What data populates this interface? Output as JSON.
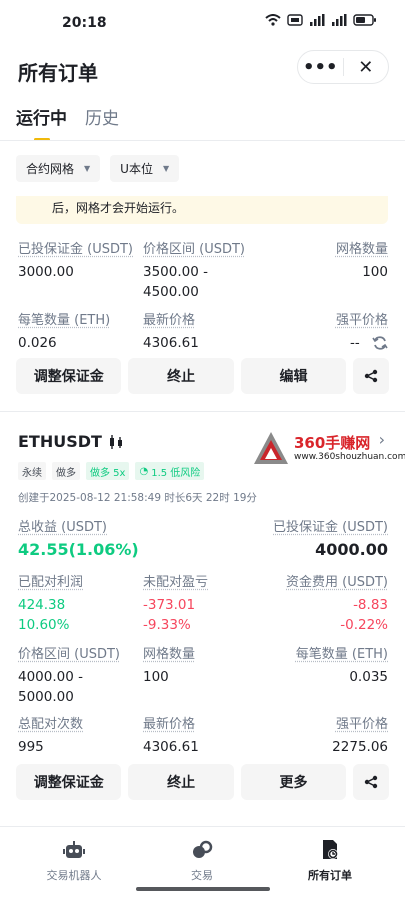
{
  "status_bar": {
    "time": "20:18",
    "wifi": "wifi-icon",
    "battery": "battery-icon"
  },
  "header": {
    "title": "所有订单",
    "more": "•••",
    "close": "✕"
  },
  "tabs": [
    {
      "label": "运行中",
      "active": true
    },
    {
      "label": "历史",
      "active": false
    }
  ],
  "filters": [
    {
      "label": "合约网格"
    },
    {
      "label": "U本位"
    }
  ],
  "notice": "后，网格才会开始运行。",
  "card_a": {
    "row1": [
      {
        "label": "已投保证金 (USDT)",
        "value": "3000.00"
      },
      {
        "label": "价格区间 (USDT)",
        "value": "3500.00 -",
        "value2": "4500.00"
      },
      {
        "label": "网格数量",
        "value": "100"
      }
    ],
    "row2": [
      {
        "label": "每笔数量 (ETH)",
        "value": "0.026"
      },
      {
        "label": "最新价格",
        "value": "4306.61"
      },
      {
        "label": "强平价格",
        "value": "--"
      }
    ],
    "buttons": {
      "margin": "调整保证金",
      "stop": "终止",
      "edit": "编辑"
    }
  },
  "card_b": {
    "pair": "ETHUSDT",
    "tags": [
      "永续",
      "做多",
      "做多 5x",
      "1.5 低风险"
    ],
    "created": "创建于2025-08-12 21:58:49  时长6天 22时 19分",
    "watermark": {
      "title": "360手赚网",
      "url": "www.360shouzhuan.com"
    },
    "row1": [
      {
        "label": "总收益 (USDT)",
        "value": "42.55(1.06%)"
      },
      {
        "label": "已投保证金 (USDT)",
        "value": "4000.00"
      }
    ],
    "row2": [
      {
        "label": "已配对利润",
        "value": "424.38",
        "value2": "10.60%"
      },
      {
        "label": "未配对盈亏",
        "value": "-373.01",
        "value2": "-9.33%"
      },
      {
        "label": "资金费用 (USDT)",
        "value": "-8.83",
        "value2": "-0.22%"
      }
    ],
    "row3": [
      {
        "label": "价格区间 (USDT)",
        "value": "4000.00 -",
        "value2": "5000.00"
      },
      {
        "label": "网格数量",
        "value": "100"
      },
      {
        "label": "每笔数量 (ETH)",
        "value": "0.035"
      }
    ],
    "row4": [
      {
        "label": "总配对次数",
        "value": "995"
      },
      {
        "label": "最新价格",
        "value": "4306.61"
      },
      {
        "label": "强平价格",
        "value": "2275.06"
      }
    ],
    "buttons": {
      "margin": "调整保证金",
      "stop": "终止",
      "more": "更多"
    }
  },
  "bottom_nav": [
    {
      "label": "交易机器人",
      "icon": "robot-icon",
      "active": false
    },
    {
      "label": "交易",
      "icon": "trade-icon",
      "active": false
    },
    {
      "label": "所有订单",
      "icon": "orders-icon",
      "active": true
    }
  ]
}
